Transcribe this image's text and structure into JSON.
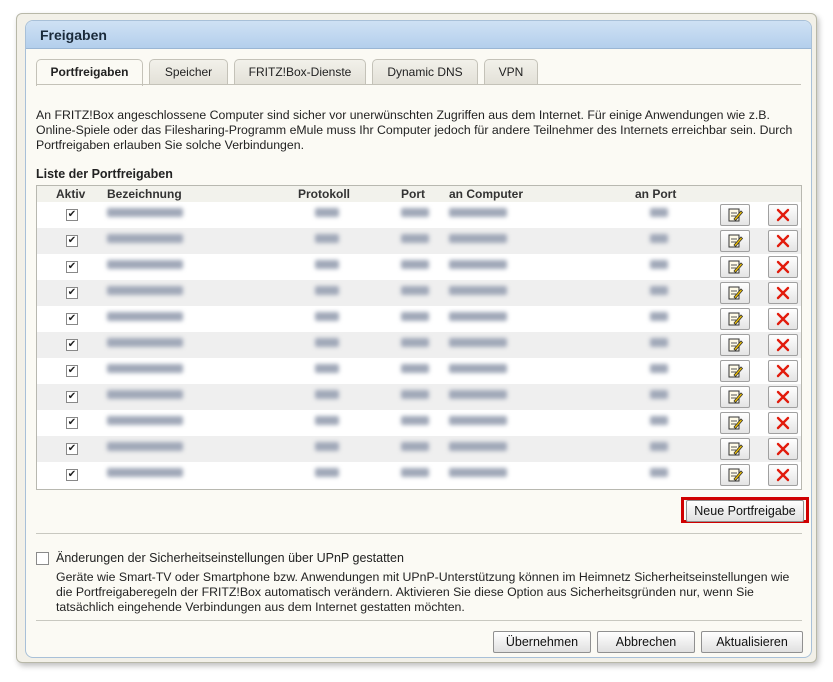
{
  "panel": {
    "title": "Freigaben"
  },
  "tabs": [
    {
      "label": "Portfreigaben",
      "active": true
    },
    {
      "label": "Speicher",
      "active": false
    },
    {
      "label": "FRITZ!Box-Dienste",
      "active": false
    },
    {
      "label": "Dynamic DNS",
      "active": false
    },
    {
      "label": "VPN",
      "active": false
    }
  ],
  "intro": "An FRITZ!Box angeschlossene Computer sind sicher vor unerwünschten Zugriffen aus dem Internet. Für einige Anwendungen wie z.B. Online-Spiele oder das Filesharing-Programm eMule muss Ihr Computer jedoch für andere Teilnehmer des Internets erreichbar sein. Durch Portfreigaben erlauben Sie solche Verbindungen.",
  "list": {
    "title": "Liste der Portfreigaben",
    "headers": {
      "active": "Aktiv",
      "name": "Bezeichnung",
      "protocol": "Protokoll",
      "port": "Port",
      "computer": "an Computer",
      "to_port": "an Port"
    },
    "row_count": 11,
    "icons": {
      "edit": "edit-note-icon",
      "delete": "delete-x-icon"
    },
    "colors": {
      "delete_x": "#e21b0c",
      "highlight": "#d00000"
    }
  },
  "new_button": "Neue Portfreigabe",
  "upnp": {
    "label": "Änderungen der Sicherheitseinstellungen über UPnP gestatten",
    "checked": false,
    "description": "Geräte wie Smart-TV oder Smartphone bzw. Anwendungen mit UPnP-Unterstützung können im Heimnetz Sicherheitseinstellungen wie die Portfreigaberegeln der FRITZ!Box automatisch verändern. Aktivieren Sie diese Option aus Sicherheitsgründen nur, wenn Sie tatsächlich eingehende Verbindungen aus dem Internet gestatten möchten."
  },
  "footer": {
    "apply": "Übernehmen",
    "cancel": "Abbrechen",
    "refresh": "Aktualisieren"
  }
}
